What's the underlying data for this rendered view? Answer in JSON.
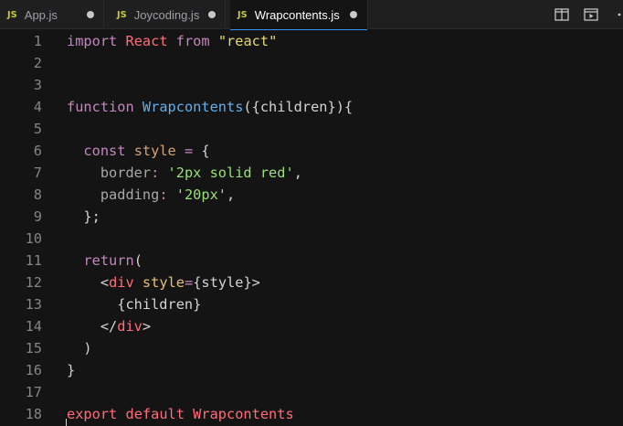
{
  "tabs": [
    {
      "icon": "JS",
      "label": "App.js",
      "modified": true,
      "active": false
    },
    {
      "icon": "JS",
      "label": "Joycoding.js",
      "modified": true,
      "active": false
    },
    {
      "icon": "JS",
      "label": "Wrapcontents.js",
      "modified": true,
      "active": true
    }
  ],
  "actions": [
    "split-editor-icon",
    "open-preview-icon",
    "more-actions-icon"
  ],
  "colors": {
    "keyword": "#c586c0",
    "identifier": "#ff6d7a",
    "string": "#e6db74",
    "string_single": "#98e07a",
    "function_name": "#61afef",
    "tab_active_border": "#3794ff",
    "js_badge": "#cbcb41"
  },
  "code": {
    "lines": [
      {
        "n": "1",
        "t": [
          [
            "kw",
            "import"
          ],
          [
            "plain",
            " "
          ],
          [
            "kw2",
            "React"
          ],
          [
            "plain",
            " "
          ],
          [
            "kw",
            "from"
          ],
          [
            "plain",
            " "
          ],
          [
            "str",
            "\"react\""
          ]
        ]
      },
      {
        "n": "2",
        "t": []
      },
      {
        "n": "3",
        "t": []
      },
      {
        "n": "4",
        "t": [
          [
            "kw",
            "function"
          ],
          [
            "plain",
            " "
          ],
          [
            "fn",
            "Wrapcontents"
          ],
          [
            "punc",
            "({children}){"
          ]
        ]
      },
      {
        "n": "5",
        "t": []
      },
      {
        "n": "6",
        "t": [
          [
            "plain",
            "  "
          ],
          [
            "kw",
            "const"
          ],
          [
            "plain",
            " "
          ],
          [
            "prop",
            "style"
          ],
          [
            "plain",
            " "
          ],
          [
            "kw",
            "="
          ],
          [
            "plain",
            " {"
          ]
        ]
      },
      {
        "n": "7",
        "t": [
          [
            "plain",
            "    "
          ],
          [
            "obj",
            "border"
          ],
          [
            "kw",
            ":"
          ],
          [
            "plain",
            " "
          ],
          [
            "str2",
            "'2px solid red'"
          ],
          [
            "plain",
            ","
          ]
        ]
      },
      {
        "n": "8",
        "t": [
          [
            "plain",
            "    "
          ],
          [
            "obj",
            "padding"
          ],
          [
            "kw",
            ":"
          ],
          [
            "plain",
            " "
          ],
          [
            "str2",
            "'20px'"
          ],
          [
            "plain",
            ","
          ]
        ]
      },
      {
        "n": "9",
        "t": [
          [
            "plain",
            "  };"
          ]
        ]
      },
      {
        "n": "10",
        "t": []
      },
      {
        "n": "11",
        "t": [
          [
            "plain",
            "  "
          ],
          [
            "kw",
            "return"
          ],
          [
            "punc",
            "("
          ]
        ]
      },
      {
        "n": "12",
        "t": [
          [
            "plain",
            "    "
          ],
          [
            "punc",
            "<"
          ],
          [
            "tag",
            "div"
          ],
          [
            "plain",
            " "
          ],
          [
            "attr",
            "style"
          ],
          [
            "kw",
            "="
          ],
          [
            "punc",
            "{style}>"
          ]
        ]
      },
      {
        "n": "13",
        "t": [
          [
            "plain",
            "      {children}"
          ]
        ]
      },
      {
        "n": "14",
        "t": [
          [
            "plain",
            "    "
          ],
          [
            "punc",
            "</"
          ],
          [
            "tag",
            "div"
          ],
          [
            "punc",
            ">"
          ]
        ]
      },
      {
        "n": "15",
        "t": [
          [
            "plain",
            "  )"
          ]
        ]
      },
      {
        "n": "16",
        "t": [
          [
            "plain",
            "}"
          ]
        ]
      },
      {
        "n": "17",
        "t": []
      },
      {
        "n": "18",
        "t": [
          [
            "kw2",
            "export"
          ],
          [
            "plain",
            " "
          ],
          [
            "kw2",
            "default"
          ],
          [
            "plain",
            " "
          ],
          [
            "kw2",
            "Wrapcontents"
          ]
        ]
      }
    ]
  }
}
